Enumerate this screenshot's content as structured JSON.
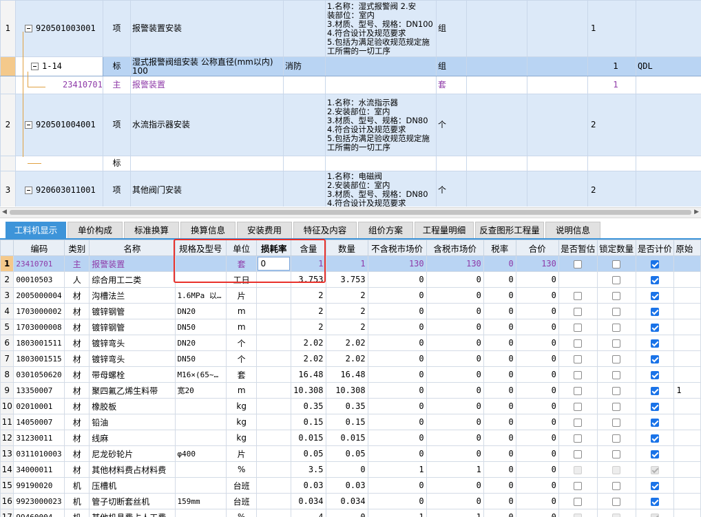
{
  "upper": {
    "rows": [
      {
        "rownum": "1",
        "code": "920501003001",
        "type": "项",
        "name": "报警装置安装",
        "spec": "",
        "desc": [
          "1.名称：湿式报警阀    2.安",
          "装部位：室内",
          "3.材质、型号、规格：DN100",
          "4.符合设计及规范要求",
          "5.包括为满足验收规范规定施",
          "工所需的一切工序"
        ],
        "unit": "组",
        "qty": "1",
        "extra": ""
      },
      {
        "rownum": "",
        "code": "1-14",
        "type": "标",
        "name": "湿式报警阀组安装 公称直径(mm以内) 100",
        "spec": "消防",
        "desc": [],
        "unit": "组",
        "qty": "1",
        "extra": "QDL"
      },
      {
        "rownum": "",
        "code": "23410701",
        "type": "主",
        "name": "报警装置",
        "spec": "",
        "desc": [],
        "unit": "套",
        "qty": "1",
        "extra": ""
      },
      {
        "rownum": "2",
        "code": "920501004001",
        "type": "项",
        "name": "水流指示器安装",
        "spec": "",
        "desc": [
          "1.名称：水流指示器",
          "2.安装部位：室内",
          "3.材质、型号、规格：DN80",
          "4.符合设计及规范要求",
          "5.包括为满足验收规范规定施",
          "工所需的一切工序"
        ],
        "unit": "个",
        "qty": "2",
        "extra": ""
      },
      {
        "rownum": "",
        "code": "",
        "type": "标",
        "name": "",
        "spec": "",
        "desc": [],
        "unit": "",
        "qty": "",
        "extra": ""
      },
      {
        "rownum": "3",
        "code": "920603011001",
        "type": "项",
        "name": "其他阀门安装",
        "spec": "",
        "desc": [
          "1.名称：电磁阀",
          "2.安装部位：室内",
          "3.材质、型号、规格：DN80",
          "4.符合设计及规范要求"
        ],
        "unit": "个",
        "qty": "2",
        "extra": ""
      }
    ]
  },
  "tabs": [
    "工料机显示",
    "单价构成",
    "标准换算",
    "换算信息",
    "安装费用",
    "特征及内容",
    "组价方案",
    "工程量明细",
    "反查图形工程量",
    "说明信息"
  ],
  "lower": {
    "headers": [
      "编码",
      "类别",
      "名称",
      "规格及型号",
      "单位",
      "损耗率",
      "含量",
      "数量",
      "不含税市场价",
      "含税市场价",
      "税率",
      "合价",
      "是否暂估",
      "锁定数量",
      "是否计价",
      "原始"
    ],
    "rows": [
      {
        "n": "1",
        "code": "23410701",
        "cat": "主",
        "name": "报警装置",
        "spec": "",
        "unit": "套",
        "loss": "0",
        "content": "1",
        "qty": "1",
        "price_ex": "130",
        "price_in": "130",
        "tax": "0",
        "total": "130",
        "est": false,
        "lock": false,
        "priced": true
      },
      {
        "n": "2",
        "code": "00010503",
        "cat": "人",
        "name": "综合用工二类",
        "spec": "",
        "unit": "工日",
        "loss": "",
        "content": "3.753",
        "qty": "3.753",
        "price_ex": "0",
        "price_in": "0",
        "tax": "0",
        "total": "0",
        "est": null,
        "lock": false,
        "priced": true
      },
      {
        "n": "3",
        "code": "2005000004",
        "cat": "材",
        "name": "沟槽法兰",
        "spec": "1.6MPa 以…",
        "unit": "片",
        "loss": "",
        "content": "2",
        "qty": "2",
        "price_ex": "0",
        "price_in": "0",
        "tax": "0",
        "total": "0",
        "est": false,
        "lock": false,
        "priced": true
      },
      {
        "n": "4",
        "code": "1703000002",
        "cat": "材",
        "name": "镀锌钢管",
        "spec": "DN20",
        "unit": "m",
        "loss": "",
        "content": "2",
        "qty": "2",
        "price_ex": "0",
        "price_in": "0",
        "tax": "0",
        "total": "0",
        "est": false,
        "lock": false,
        "priced": true
      },
      {
        "n": "5",
        "code": "1703000008",
        "cat": "材",
        "name": "镀锌钢管",
        "spec": "DN50",
        "unit": "m",
        "loss": "",
        "content": "2",
        "qty": "2",
        "price_ex": "0",
        "price_in": "0",
        "tax": "0",
        "total": "0",
        "est": false,
        "lock": false,
        "priced": true
      },
      {
        "n": "6",
        "code": "1803001511",
        "cat": "材",
        "name": "镀锌弯头",
        "spec": "DN20",
        "unit": "个",
        "loss": "",
        "content": "2.02",
        "qty": "2.02",
        "price_ex": "0",
        "price_in": "0",
        "tax": "0",
        "total": "0",
        "est": false,
        "lock": false,
        "priced": true
      },
      {
        "n": "7",
        "code": "1803001515",
        "cat": "材",
        "name": "镀锌弯头",
        "spec": "DN50",
        "unit": "个",
        "loss": "",
        "content": "2.02",
        "qty": "2.02",
        "price_ex": "0",
        "price_in": "0",
        "tax": "0",
        "total": "0",
        "est": false,
        "lock": false,
        "priced": true
      },
      {
        "n": "8",
        "code": "0301050620",
        "cat": "材",
        "name": "带母螺栓",
        "spec": "M16×(65~…",
        "unit": "套",
        "loss": "",
        "content": "16.48",
        "qty": "16.48",
        "price_ex": "0",
        "price_in": "0",
        "tax": "0",
        "total": "0",
        "est": false,
        "lock": false,
        "priced": true
      },
      {
        "n": "9",
        "code": "13350007",
        "cat": "材",
        "name": "聚四氟乙烯生料带",
        "spec": "宽20",
        "unit": "m",
        "loss": "",
        "content": "10.308",
        "qty": "10.308",
        "price_ex": "0",
        "price_in": "0",
        "tax": "0",
        "total": "0",
        "est": false,
        "lock": false,
        "priced": true,
        "orig": "1"
      },
      {
        "n": "10",
        "code": "02010001",
        "cat": "材",
        "name": "橡胶板",
        "spec": "",
        "unit": "kg",
        "loss": "",
        "content": "0.35",
        "qty": "0.35",
        "price_ex": "0",
        "price_in": "0",
        "tax": "0",
        "total": "0",
        "est": false,
        "lock": false,
        "priced": true
      },
      {
        "n": "11",
        "code": "14050007",
        "cat": "材",
        "name": "铅油",
        "spec": "",
        "unit": "kg",
        "loss": "",
        "content": "0.15",
        "qty": "0.15",
        "price_ex": "0",
        "price_in": "0",
        "tax": "0",
        "total": "0",
        "est": false,
        "lock": false,
        "priced": true
      },
      {
        "n": "12",
        "code": "31230011",
        "cat": "材",
        "name": "线麻",
        "spec": "",
        "unit": "kg",
        "loss": "",
        "content": "0.015",
        "qty": "0.015",
        "price_ex": "0",
        "price_in": "0",
        "tax": "0",
        "total": "0",
        "est": false,
        "lock": false,
        "priced": true
      },
      {
        "n": "13",
        "code": "0311010003",
        "cat": "材",
        "name": "尼龙砂轮片",
        "spec": "φ400",
        "unit": "片",
        "loss": "",
        "content": "0.05",
        "qty": "0.05",
        "price_ex": "0",
        "price_in": "0",
        "tax": "0",
        "total": "0",
        "est": false,
        "lock": false,
        "priced": true
      },
      {
        "n": "14",
        "code": "34000011",
        "cat": "材",
        "name": "其他材料费占材料费",
        "spec": "",
        "unit": "%",
        "loss": "",
        "content": "3.5",
        "qty": "0",
        "price_ex": "1",
        "price_in": "1",
        "tax": "0",
        "total": "0",
        "est": "dis",
        "lock": "dis",
        "priced": "dis"
      },
      {
        "n": "15",
        "code": "99190020",
        "cat": "机",
        "name": "压槽机",
        "spec": "",
        "unit": "台班",
        "loss": "",
        "content": "0.03",
        "qty": "0.03",
        "price_ex": "0",
        "price_in": "0",
        "tax": "0",
        "total": "0",
        "est": false,
        "lock": false,
        "priced": true
      },
      {
        "n": "16",
        "code": "9923000023",
        "cat": "机",
        "name": "管子切断套丝机",
        "spec": "159mm",
        "unit": "台班",
        "loss": "",
        "content": "0.034",
        "qty": "0.034",
        "price_ex": "0",
        "price_in": "0",
        "tax": "0",
        "total": "0",
        "est": false,
        "lock": false,
        "priced": true
      },
      {
        "n": "17",
        "code": "99460004",
        "cat": "机",
        "name": "其他机具费占人工费",
        "spec": "",
        "unit": "%",
        "loss": "",
        "content": "4",
        "qty": "0",
        "price_ex": "1",
        "price_in": "1",
        "tax": "0",
        "total": "0",
        "est": "dis",
        "lock": "dis",
        "priced": "dis"
      }
    ]
  }
}
